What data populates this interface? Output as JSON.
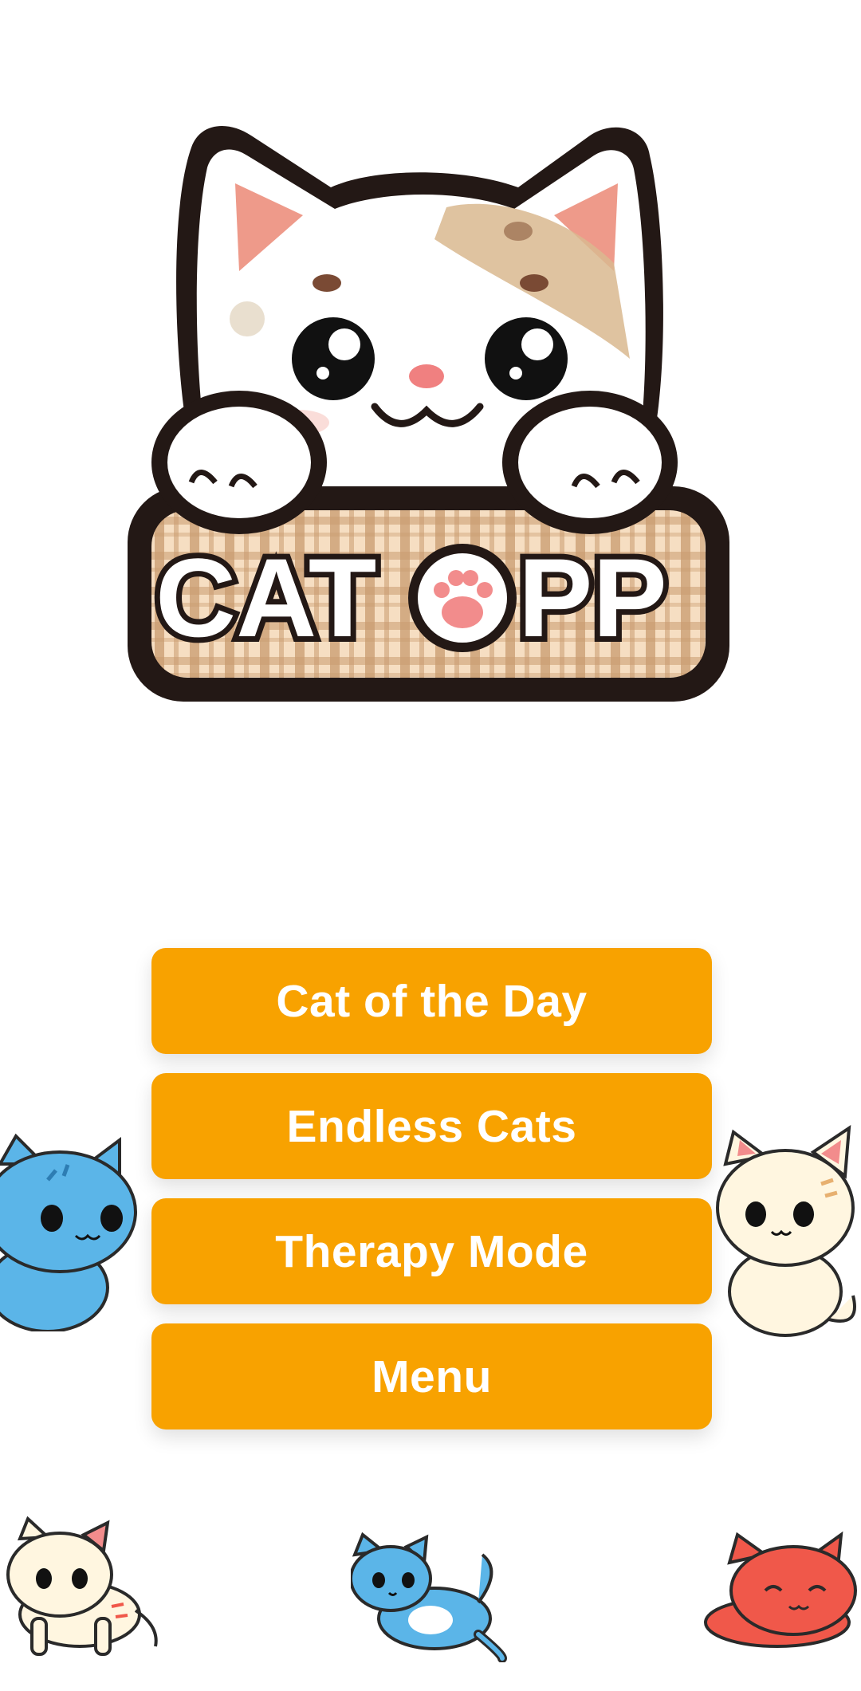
{
  "logo": {
    "text_left": "CAT",
    "text_right": "PP",
    "icon": "paw-icon",
    "colors": {
      "outline": "#231815",
      "sign_fill": "#E8C6A0",
      "plaid_dark": "#C89A6E",
      "plaid_light": "#F6DEC2",
      "ear_inner": "#EE9A8A",
      "patch": "#D9B88F",
      "nose": "#F08080"
    }
  },
  "menu": {
    "buttons": [
      {
        "label": "Cat of the Day"
      },
      {
        "label": "Endless Cats"
      },
      {
        "label": "Therapy Mode"
      },
      {
        "label": "Menu"
      }
    ],
    "button_color": "#F8A200",
    "text_color": "#FFFFFF"
  },
  "decorations": {
    "cats": [
      {
        "icon": "blue-cat-sitting-icon",
        "color": "#5BB5E8"
      },
      {
        "icon": "cream-cat-sitting-icon",
        "color": "#FFF6E0"
      },
      {
        "icon": "cream-cat-walking-icon",
        "color": "#FFF6E0"
      },
      {
        "icon": "blue-cat-lying-icon",
        "color": "#5BB5E8"
      },
      {
        "icon": "red-cat-sleeping-icon",
        "color": "#F0584A"
      }
    ]
  }
}
